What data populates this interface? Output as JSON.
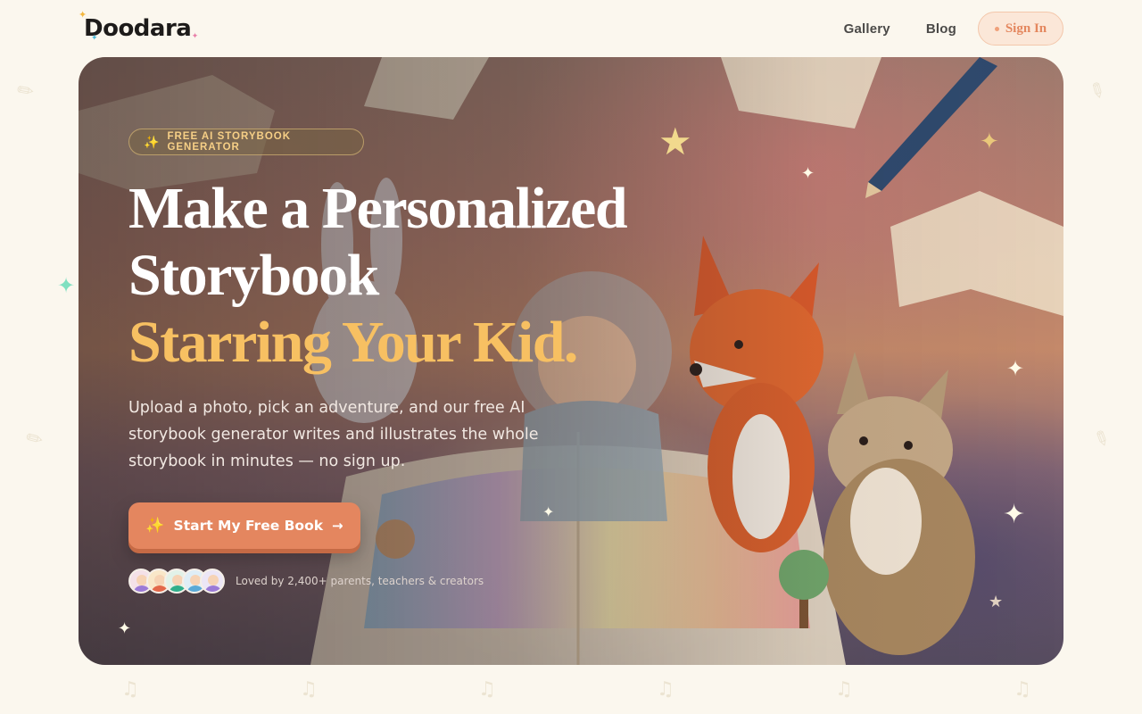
{
  "brand": {
    "name": "Doodara"
  },
  "nav": {
    "links": [
      "Gallery",
      "Blog"
    ],
    "signin_label": "Sign In"
  },
  "hero": {
    "badge": "FREE AI STORYBOOK GENERATOR",
    "headline_line1": "Make a Personalized",
    "headline_line2": "Storybook",
    "headline_accent": "Starring Your Kid.",
    "subtitle": "Upload a photo, pick an adventure, and our free AI storybook generator writes and illustrates the whole storybook in minutes — no sign up.",
    "cta_label": "Start My Free Book",
    "social_proof": "Loved by 2,400+ parents, teachers & creators"
  },
  "colors": {
    "accent": "#e4865f",
    "headline_accent": "#f7c062",
    "background": "#fbf7ee"
  },
  "icons": {
    "badge": "sparkles-icon",
    "cta": "sparkles-icon",
    "cta_arrow": "arrow-right-icon"
  }
}
